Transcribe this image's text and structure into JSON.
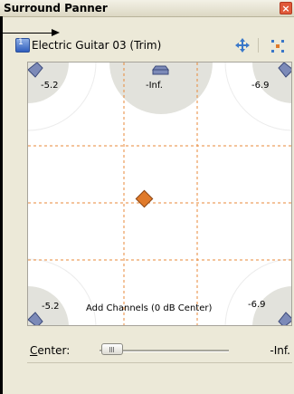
{
  "window": {
    "title": "Surround Panner",
    "close_glyph": "×"
  },
  "track": {
    "number": "1",
    "name": "Electric Guitar 03 (Trim)"
  },
  "panner": {
    "levels": {
      "front_left": "-5.2",
      "front_center": "-Inf.",
      "front_right": "-6.9",
      "rear_left": "-5.2",
      "rear_right": "-6.9"
    },
    "add_channels_label": "Add Channels (0 dB Center)",
    "colors": {
      "grid_line": "#e8893a",
      "pan_point": "#e07a2a",
      "speaker_zone": "#e2e2dc"
    }
  },
  "center": {
    "label_accel": "C",
    "label_rest": "enter:",
    "value": "-Inf."
  },
  "icons": [
    "track-icon",
    "move-icon",
    "mode-icon",
    "speaker-icon",
    "close-icon"
  ]
}
